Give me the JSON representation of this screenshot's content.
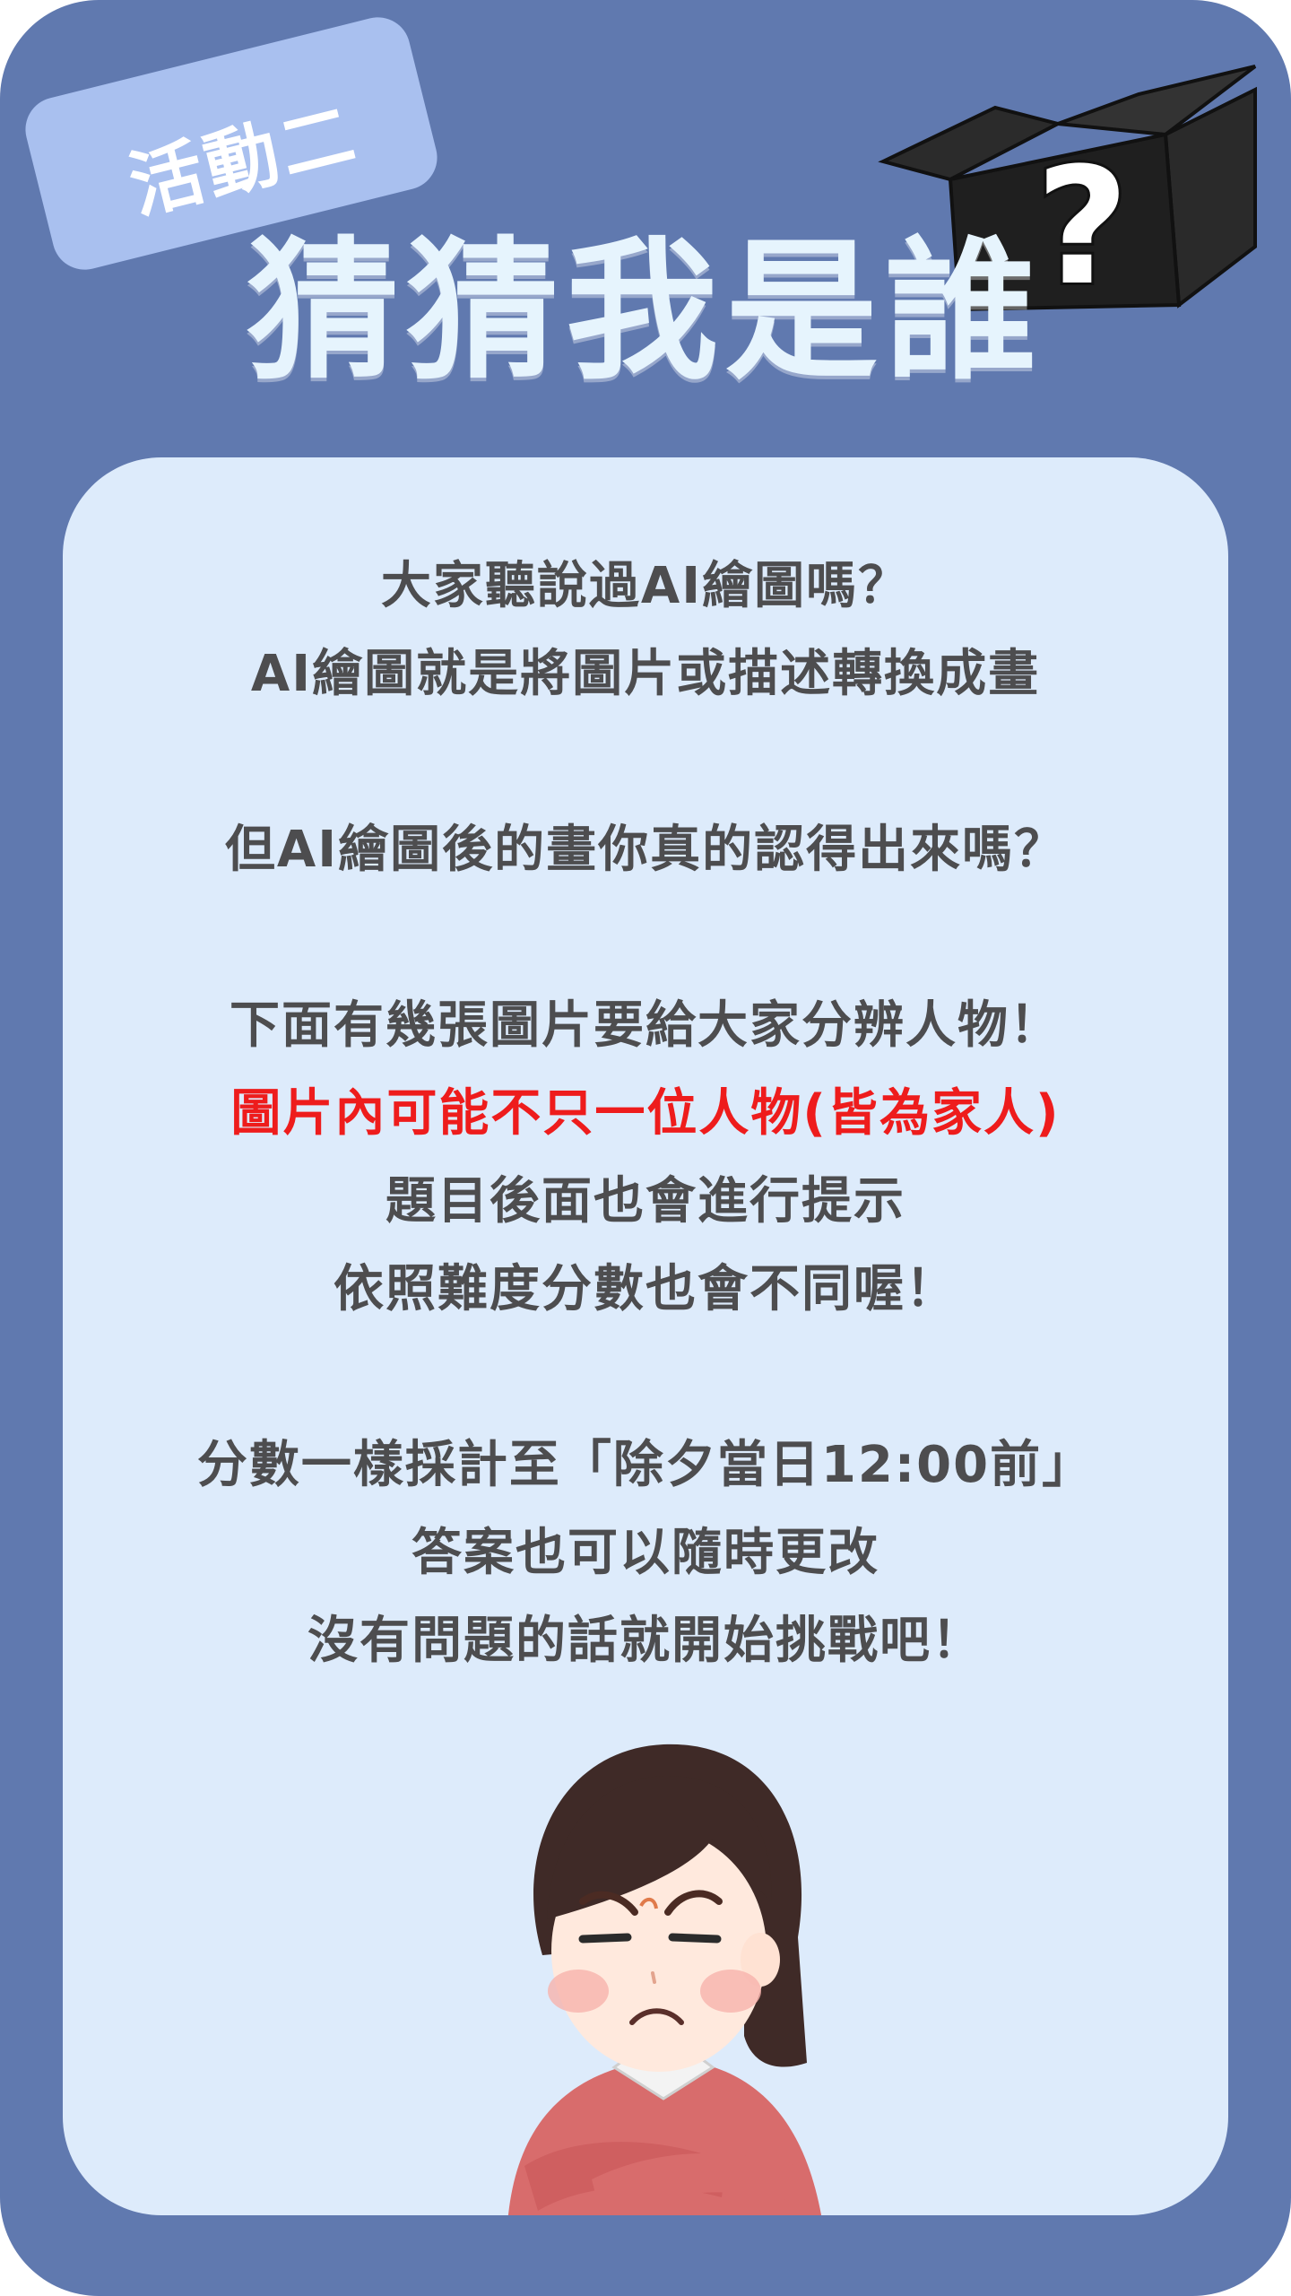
{
  "badge": {
    "label": "活動二"
  },
  "title": "猜猜我是誰",
  "box_mark": "?",
  "intro": [
    {
      "text": "大家聽說過AI繪圖嗎？",
      "style": "normal"
    },
    {
      "text": "AI繪圖就是將圖片或描述轉換成畫",
      "style": "normal"
    },
    {
      "text": "",
      "style": "gap"
    },
    {
      "text": "但AI繪圖後的畫你真的認得出來嗎？",
      "style": "normal"
    },
    {
      "text": "",
      "style": "gap"
    },
    {
      "text": "下面有幾張圖片要給大家分辨人物！",
      "style": "normal"
    },
    {
      "text": "圖片內可能不只一位人物(皆為家人)",
      "style": "red"
    },
    {
      "text": "題目後面也會進行提示",
      "style": "normal"
    },
    {
      "text": "依照難度分數也會不同喔！",
      "style": "normal"
    },
    {
      "text": "",
      "style": "gap"
    },
    {
      "text": "分數一樣採計至「除夕當日12:00前」",
      "style": "normal"
    },
    {
      "text": "答案也可以隨時更改",
      "style": "normal"
    },
    {
      "text": "沒有問題的話就開始挑戰吧！",
      "style": "normal"
    }
  ],
  "colors": {
    "background": "#6079af",
    "panel": "#ddebfb",
    "badge": "#a9c0ef",
    "text": "#4d4d4f",
    "highlight": "#ee1c1c",
    "title": "#e6f4fd"
  },
  "icons": {
    "box": "black-question-box-icon",
    "character": "frowning-woman-arms-crossed-illustration"
  }
}
